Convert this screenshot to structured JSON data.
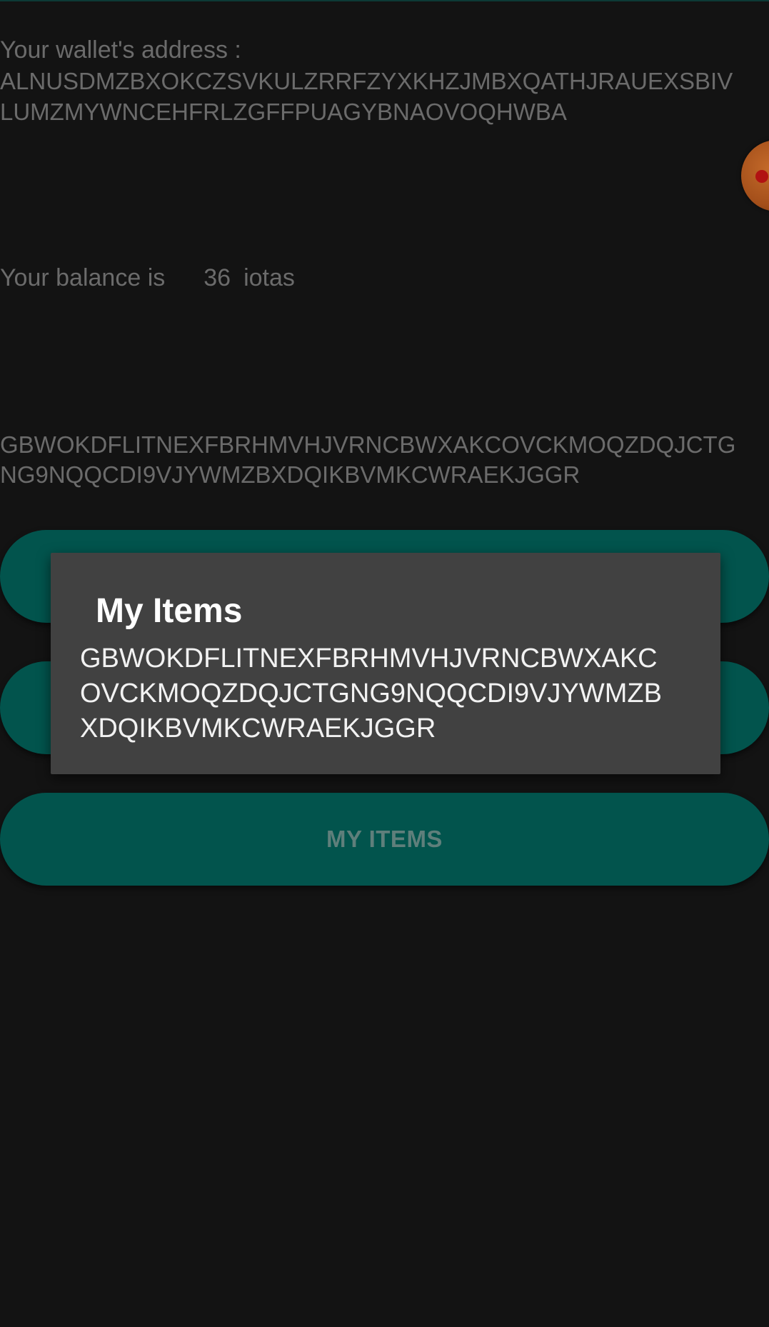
{
  "wallet": {
    "address_label": "Your wallet's address :",
    "address_line1": "ALNUSDMZBXOKCZSVKULZRRFZYXKHZJMBXQATHJRAUEXSBIV",
    "address_line2": "LUMZMYWNCEHFRLZGFFPUAGYBNAOVOQHWBA"
  },
  "balance": {
    "label": "Your balance is",
    "value": "36",
    "unit": "iotas"
  },
  "item_display": {
    "line1": "GBWOKDFLITNEXFBRHMVHJVRNCBWXAKCOVCKMOQZDQJCTG",
    "line2": "NG9NQQCDI9VJYWMZBXDQIKBVMKCWRAEKJGGR"
  },
  "buttons": {
    "button1_label": "",
    "button2_label": "",
    "my_items_label": "MY ITEMS"
  },
  "dialog": {
    "title": "My Items",
    "body_line1": "GBWOKDFLITNEXFBRHMVHJVRNCBWXAKC",
    "body_line2": "OVCKMOQZDQJCTGNG9NQQCDI9VJYWMZB",
    "body_line3": "XDQIKBVMKCWRAEKJGGR"
  },
  "colors": {
    "background": "#131313",
    "accent": "#02544d",
    "dialog_background": "#414141",
    "muted_text": "#6b6b6b"
  },
  "icons": {
    "floating_button": "floating-action-icon"
  }
}
